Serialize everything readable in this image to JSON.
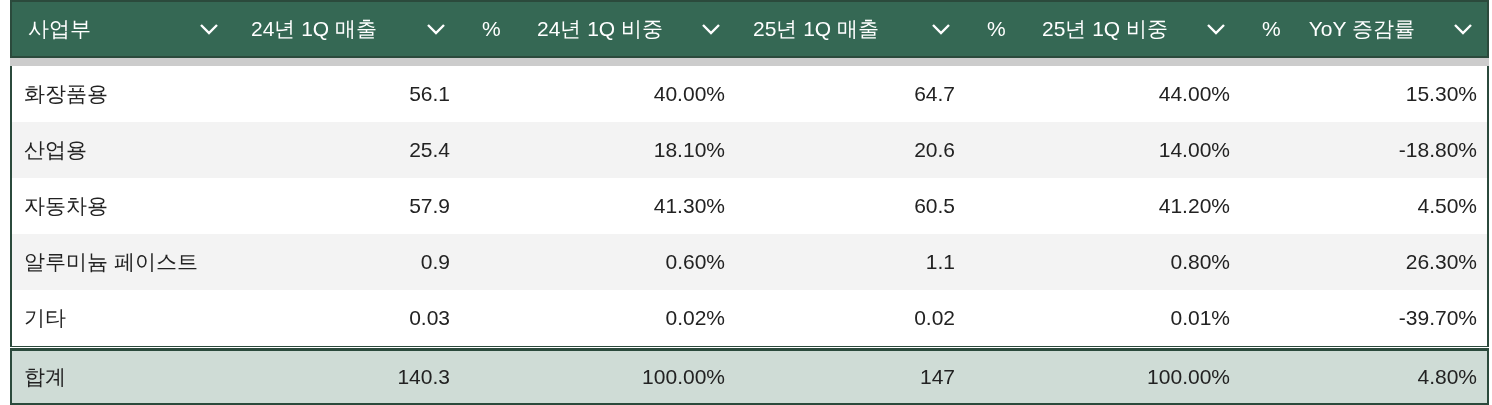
{
  "table": {
    "columns": [
      {
        "label": "사업부"
      },
      {
        "label": "24년 1Q 매출"
      },
      {
        "label": "24년 1Q 비중",
        "prefix": "%"
      },
      {
        "label": "25년 1Q 매출"
      },
      {
        "label": "25년 1Q 비중",
        "prefix": "%"
      },
      {
        "label": "YoY 증감률",
        "prefix": "%"
      }
    ],
    "rows": [
      [
        "화장품용",
        "56.1",
        "40.00%",
        "64.7",
        "44.00%",
        "15.30%"
      ],
      [
        "산업용",
        "25.4",
        "18.10%",
        "20.6",
        "14.00%",
        "-18.80%"
      ],
      [
        "자동차용",
        "57.9",
        "41.30%",
        "60.5",
        "41.20%",
        "4.50%"
      ],
      [
        "알루미늄 페이스트",
        "0.9",
        "0.60%",
        "1.1",
        "0.80%",
        "26.30%"
      ],
      [
        "기타",
        "0.03",
        "0.02%",
        "0.02",
        "0.01%",
        "-39.70%"
      ]
    ],
    "total": [
      "합계",
      "140.3",
      "100.00%",
      "147",
      "100.00%",
      "4.80%"
    ]
  }
}
